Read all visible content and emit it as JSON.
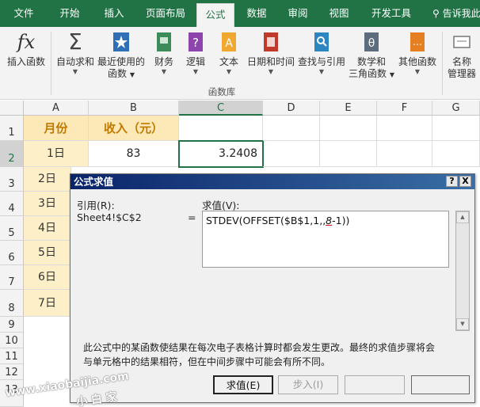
{
  "ribbon_tabs": {
    "file": "文件",
    "home": "开始",
    "insert": "插入",
    "layout": "页面布局",
    "formulas": "公式",
    "data": "数据",
    "review": "审阅",
    "view": "视图",
    "developer": "开发工具",
    "tell_me": "告诉我此"
  },
  "ribbon": {
    "insert_function": "插入函数",
    "autosum": "自动求和",
    "recent_line1": "最近使用的",
    "recent_line2": "函数",
    "financial": "财务",
    "logical": "逻辑",
    "text": "文本",
    "datetime": "日期和时间",
    "lookup": "查找与引用",
    "math_line1": "数学和",
    "math_line2": "三角函数",
    "other": "其他函数",
    "name_line1": "名称",
    "name_line2": "管理器",
    "group_label": "函数库",
    "fx_glyph": "fx",
    "sigma_glyph": "Σ"
  },
  "sheet": {
    "columns": [
      "A",
      "B",
      "C",
      "D",
      "E",
      "F",
      "G"
    ],
    "rows": [
      "1",
      "2",
      "3",
      "4",
      "5",
      "6",
      "7",
      "8",
      "9",
      "10",
      "11",
      "12",
      "13"
    ],
    "a1": "月份",
    "b1": "收入（元）",
    "a2": "1日",
    "b2": "83",
    "c2": "3.2408",
    "a3": "2日",
    "a4": "3日",
    "a5": "4日",
    "a6": "5日",
    "a7": "6日",
    "a8": "7日"
  },
  "dialog": {
    "title": "公式求值",
    "help": "?",
    "close": "X",
    "reference_label": "引用(R):",
    "reference_value": "Sheet4!$C$2",
    "equals": "=",
    "evaluation_label": "求值(V):",
    "formula_prefix": "STDEV(OFFSET($B$1,1,,",
    "formula_highlight": "8",
    "formula_suffix": "-1))",
    "note_line1": "此公式中的某函数使结果在每次电子表格计算时都会发生更改。最终的求值步骤将会",
    "note_line2": "与单元格中的结果相符，但在中间步骤中可能会有所不同。",
    "evaluate_button": "求值(E)",
    "step_in_button": "步入(I)"
  },
  "watermark": {
    "line1": "www.xiaobaijia.com",
    "line2": "小 白 家"
  },
  "colors": {
    "excel_green": "#217346",
    "header_fill": "#fde9b8",
    "month_fill": "#fdf0c9"
  }
}
